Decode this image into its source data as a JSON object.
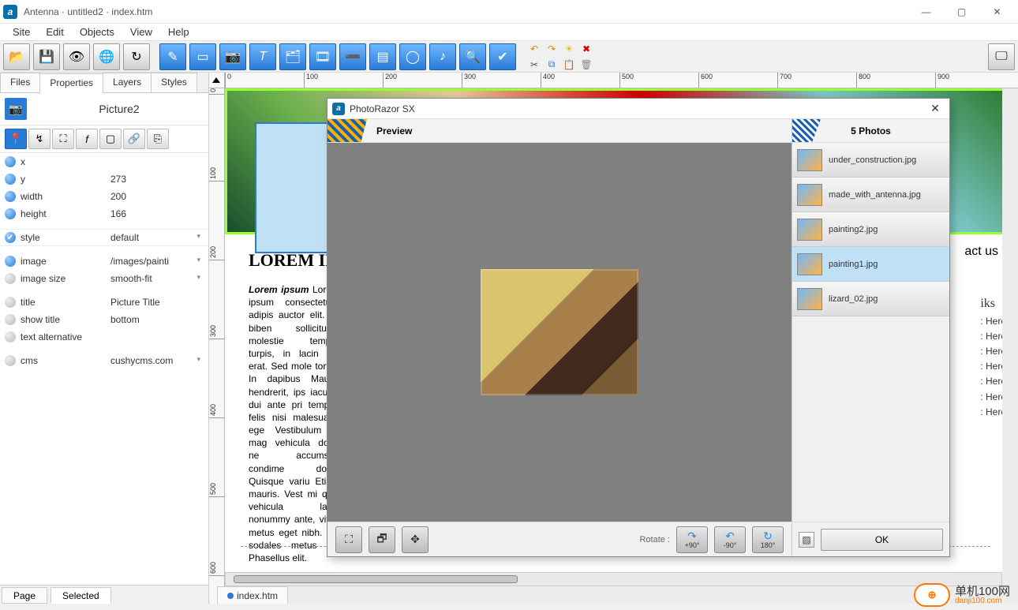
{
  "window": {
    "title": "Antenna · untitled2 · index.htm"
  },
  "menu": [
    "Site",
    "Edit",
    "Objects",
    "View",
    "Help"
  ],
  "leftTabs": [
    "Files",
    "Properties",
    "Layers",
    "Styles"
  ],
  "leftActiveTab": "Properties",
  "object": {
    "name": "Picture2"
  },
  "props": {
    "x": "",
    "y": "273",
    "width": "200",
    "height": "166",
    "style": "default",
    "image": "/images/painti",
    "image_size": "smooth-fit",
    "title": "Picture Title",
    "show_title": "bottom",
    "text_alternative": "",
    "cms": "cushycms.com"
  },
  "propLabels": {
    "x": "x",
    "y": "y",
    "width": "width",
    "height": "height",
    "style": "style",
    "image": "image",
    "image_size": "image size",
    "title": "title",
    "show_title": "show title",
    "text_alternative": "text alternative",
    "cms": "cms"
  },
  "bottomTabs": [
    "Page",
    "Selected"
  ],
  "bottomActive": "Selected",
  "docTab": "index.htm",
  "ruler_h": [
    0,
    100,
    200,
    300,
    400,
    500,
    600,
    700,
    800,
    900
  ],
  "ruler_v": [
    0,
    100,
    200,
    300,
    400,
    500,
    600
  ],
  "pageContent": {
    "heading": "LOREM IPSU",
    "lorem": "Lorem ipsum consectetuer adipis auctor elit. Ut biben sollicitudin molestie tempor turpis, in lacin vel erat. Sed mole tortor. In dapibus Mauris hendrerit, ips iaculis, dui ante pri tempus felis nisi malesuada ege Vestibulum in mag vehicula dolor ne accumsan condime dolor. Quisque variu Etiam mauris. Vest mi quis vehicula lacin nonummy ante, vitae metus eget nibh. Qu sodales metus bib Phasellus elit.",
    "nav": "act us",
    "linksTitle": "iks",
    "links": [
      ": Here",
      ": Here",
      ": Here",
      ": Here",
      ": Here",
      ": Here",
      ": Here"
    ]
  },
  "dialog": {
    "title": "PhotoRazor SX",
    "previewLabel": "Preview",
    "rotateLabel": "Rotate :",
    "rotations": [
      "+90°",
      "-90°",
      "180°"
    ],
    "countLabel": "5 Photos",
    "okLabel": "OK",
    "photos": [
      {
        "name": "under_construction.jpg"
      },
      {
        "name": "made_with_antenna.jpg"
      },
      {
        "name": "painting2.jpg"
      },
      {
        "name": "painting1.jpg",
        "selected": true
      },
      {
        "name": "lizard_02.jpg"
      }
    ]
  },
  "watermark": {
    "cn": "单机100网",
    "dom": "danji100.com"
  }
}
